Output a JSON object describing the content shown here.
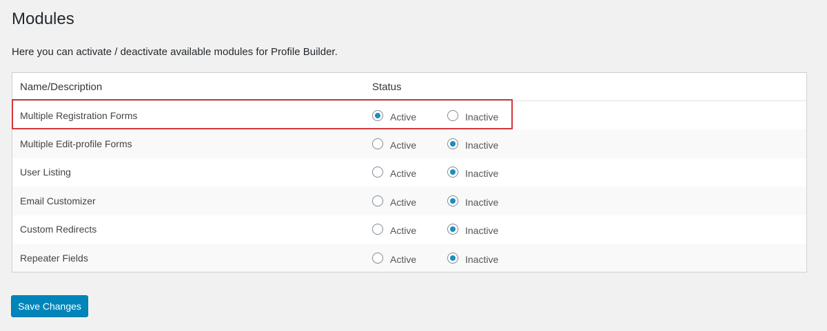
{
  "page": {
    "title": "Modules",
    "description": "Here you can activate / deactivate available modules for Profile Builder."
  },
  "table": {
    "headers": {
      "name": "Name/Description",
      "status": "Status"
    },
    "active_label": "Active",
    "inactive_label": "Inactive",
    "rows": [
      {
        "name": "Multiple Registration Forms",
        "status": "active",
        "highlighted": true
      },
      {
        "name": "Multiple Edit-profile Forms",
        "status": "inactive"
      },
      {
        "name": "User Listing",
        "status": "inactive"
      },
      {
        "name": "Email Customizer",
        "status": "inactive"
      },
      {
        "name": "Custom Redirects",
        "status": "inactive"
      },
      {
        "name": "Repeater Fields",
        "status": "inactive"
      }
    ]
  },
  "footer": {
    "save_label": "Save Changes"
  },
  "colors": {
    "accent": "#0085ba",
    "radio_checked": "#1e8cbe",
    "highlight": "#d63638"
  }
}
